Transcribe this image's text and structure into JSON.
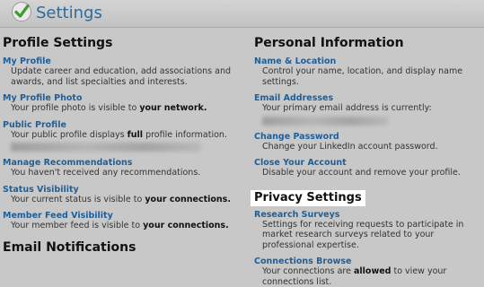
{
  "header": {
    "title": "Settings",
    "icon": "checkmark-icon"
  },
  "left": {
    "profile_settings_heading": "Profile Settings",
    "items": [
      {
        "label": "My Profile",
        "desc": "Update career and education, add associations and awards, and list specialties and interests."
      },
      {
        "label": "My Profile Photo",
        "desc_pre": "Your profile photo is visible to ",
        "desc_bold": "your network."
      },
      {
        "label": "Public Profile",
        "desc_pre": "Your public profile displays ",
        "desc_bold": "full",
        "desc_post": " profile information."
      },
      {
        "label": "Manage Recommendations",
        "desc": "You haven't received any recommendations."
      },
      {
        "label": "Status Visibility",
        "desc_pre": "Your current status is visible to ",
        "desc_bold": "your connections."
      },
      {
        "label": "Member Feed Visibility",
        "desc_pre": "Your member feed is visible to ",
        "desc_bold": "your connections."
      }
    ],
    "email_notifications_heading": "Email Notifications"
  },
  "right": {
    "personal_information_heading": "Personal Information",
    "items": [
      {
        "label": "Name & Location",
        "desc": "Control your name, location, and display name settings."
      },
      {
        "label": "Email Addresses",
        "desc": "Your primary email address is currently:"
      },
      {
        "label": "Change Password",
        "desc": "Change your LinkedIn account password."
      },
      {
        "label": "Close Your Account",
        "desc": "Disable your account and remove your profile."
      }
    ],
    "privacy_settings_heading": "Privacy Settings",
    "privacy_items": [
      {
        "label": "Research Surveys",
        "desc": "Settings for receiving requests to participate in market research surveys related to your professional expertise."
      },
      {
        "label": "Connections Browse",
        "desc_pre": "Your connections are ",
        "desc_bold": "allowed",
        "desc_post": " to view your connections list."
      }
    ]
  },
  "colors": {
    "link": "#1f5f97",
    "title": "#2f6a9a",
    "background": "#c8c8c8"
  }
}
